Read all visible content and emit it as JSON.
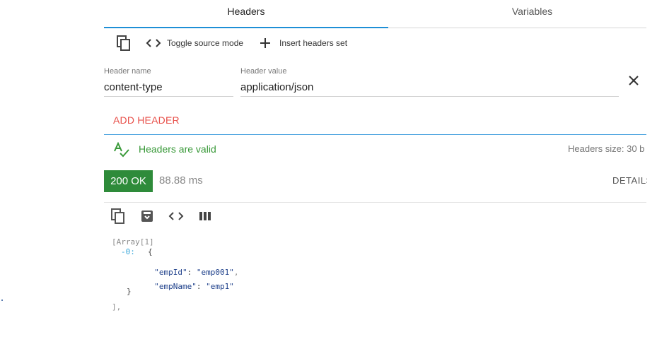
{
  "tabs": [
    {
      "label": "Headers",
      "active": true
    },
    {
      "label": "Variables",
      "active": false
    }
  ],
  "toolbar": {
    "copy_icon": "copy-icon",
    "toggle_source_label": "Toggle source mode",
    "insert_headers_label": "Insert headers set"
  },
  "header_row": {
    "name_label": "Header name",
    "name_value": "content-type",
    "value_label": "Header value",
    "value_value": "application/json"
  },
  "add_header_label": "ADD HEADER",
  "validation": {
    "message": "Headers are valid",
    "size_text": "Headers size: 30 b"
  },
  "response": {
    "status": "200 OK",
    "status_color": "#2e8b3a",
    "time": "88.88 ms",
    "details_label": "DETAILS"
  },
  "json_view": {
    "array_label": "[Array[1]",
    "index_label": "-0:",
    "open_brace": "{",
    "key1": "\"empId\"",
    "value1": "\"emp001\"",
    "key2": "\"empName\"",
    "value2": "\"emp1\"",
    "close_brace": "}",
    "close_array": "],"
  },
  "colors": {
    "accent": "#1e8fd6",
    "add_header": "#e8504a",
    "valid": "#3a9a3a"
  }
}
